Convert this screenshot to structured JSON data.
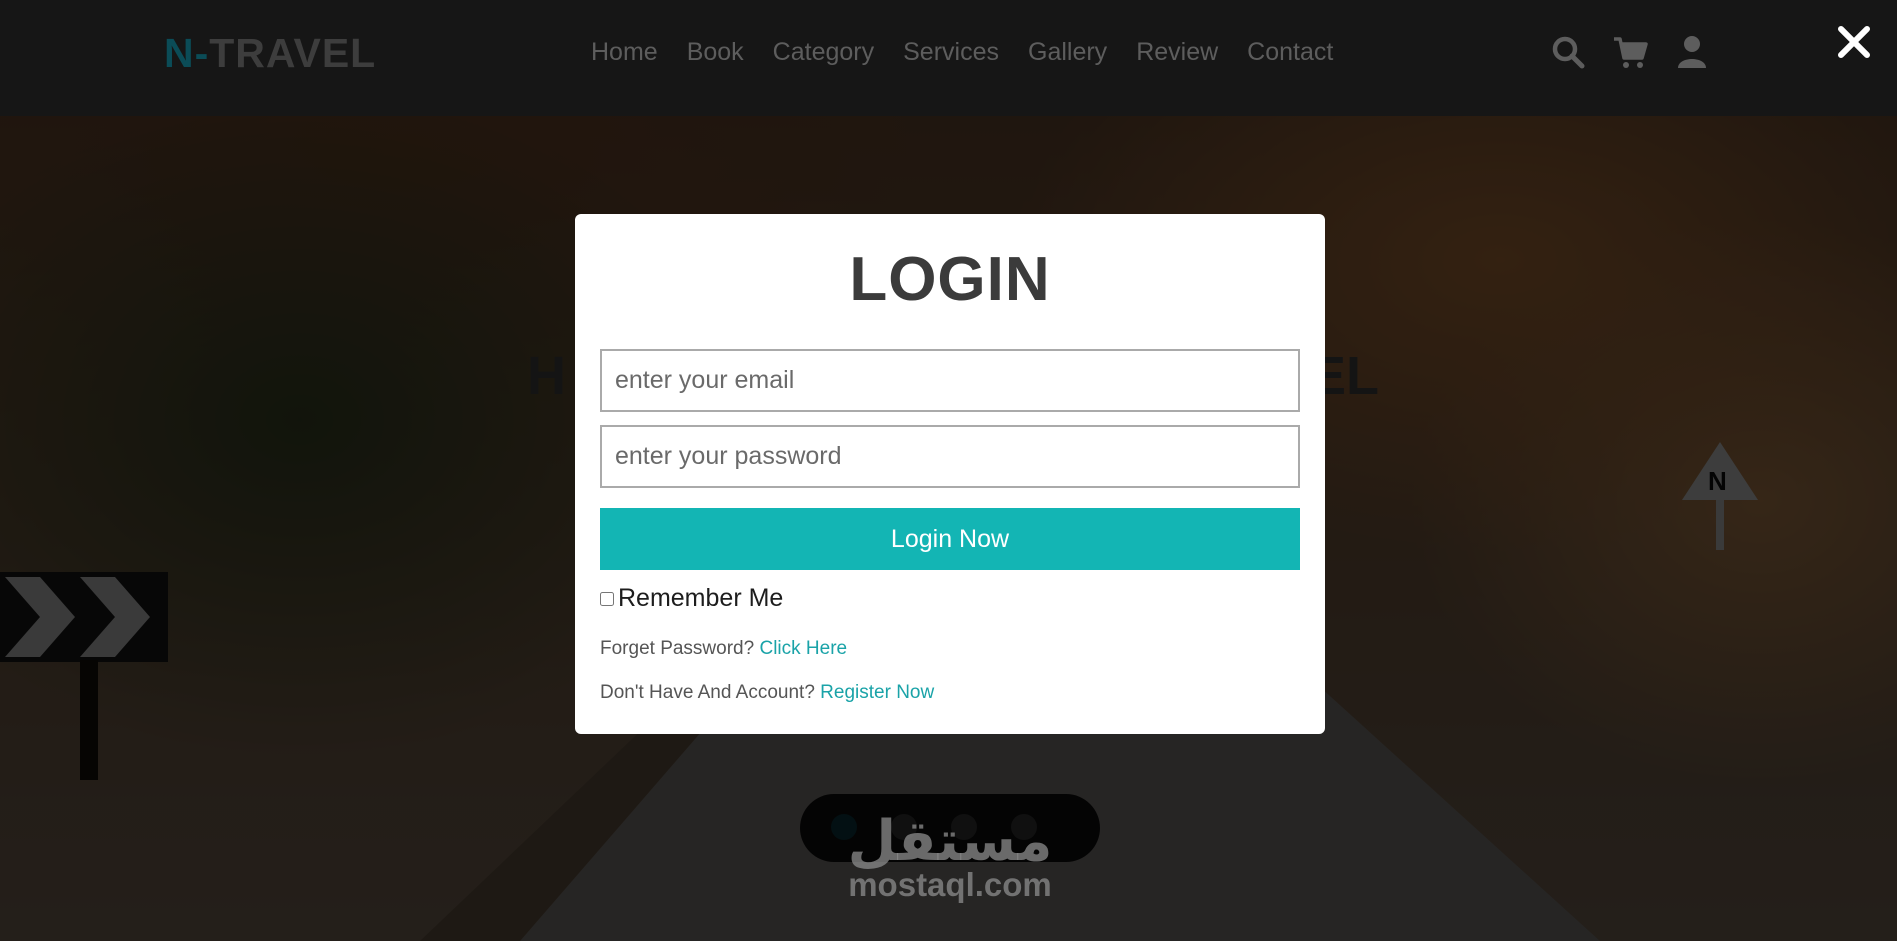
{
  "brand": {
    "prefix": "N-",
    "name": "TRAVEL",
    "accent_color": "#0b4c57"
  },
  "nav": {
    "items": [
      "Home",
      "Book",
      "Category",
      "Services",
      "Gallery",
      "Review",
      "Contact"
    ]
  },
  "header_icons": [
    "search-icon",
    "cart-icon",
    "user-icon"
  ],
  "close_icon": "close-icon",
  "hero": {
    "title_left": "H",
    "title_right": "EL"
  },
  "login": {
    "title": "LOGIN",
    "email_placeholder": "enter your email",
    "password_placeholder": "enter your password",
    "submit_label": "Login Now",
    "remember_label": "Remember Me",
    "remember_checked": false,
    "forget_text": "Forget Password?",
    "forget_link": "Click Here",
    "register_text": "Don't Have And Account?",
    "register_link": "Register Now",
    "button_color": "#13b5b4",
    "link_color": "#1aa3a8"
  },
  "slider": {
    "dot_count": 4,
    "active_index": 0
  },
  "watermark": {
    "arabic": "مستقل",
    "latin": "mostaql.com"
  }
}
